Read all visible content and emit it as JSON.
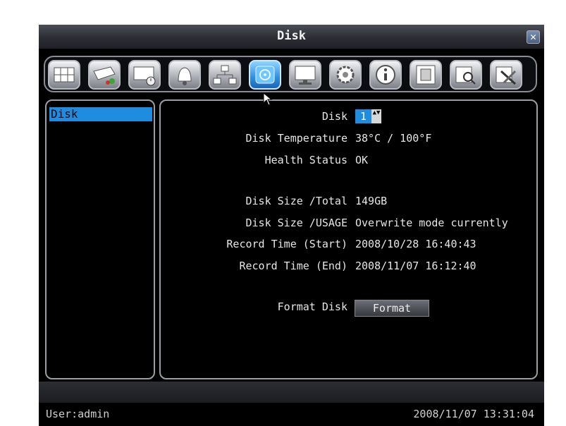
{
  "window": {
    "title": "Disk",
    "close_label": "✕"
  },
  "toolbar": {
    "icons": [
      "camera-grid-icon",
      "paint-icon",
      "record-schedule-icon",
      "alarm-bell-icon",
      "network-icon",
      "disk-icon",
      "monitor-icon",
      "settings-gear-icon",
      "info-icon",
      "film-icon",
      "search-icon",
      "tools-icon"
    ],
    "active": "disk-icon"
  },
  "sidebar": {
    "items": [
      {
        "label": "Disk",
        "selected": true
      }
    ]
  },
  "main": {
    "disk_label": "Disk",
    "disk_value": "1",
    "disk_stepper": "▲▼",
    "temperature_label": "Disk Temperature",
    "temperature_value": "38°C / 100°F",
    "health_label": "Health Status",
    "health_value": "OK",
    "size_total_label": "Disk Size /Total",
    "size_total_value": "149GB",
    "size_usage_label": "Disk Size /USAGE",
    "size_usage_value": "Overwrite mode currently",
    "record_start_label": "Record Time (Start)",
    "record_start_value": "2008/10/28  16:40:43",
    "record_end_label": "Record Time (End)",
    "record_end_value": "2008/11/07  16:12:40",
    "format_label": "Format Disk",
    "format_button": "Format"
  },
  "status": {
    "user": "User:admin",
    "datetime": "2008/11/07  13:31:04"
  },
  "colors": {
    "accent": "#1e8de0",
    "background": "#000000",
    "text": "#e6e6e6"
  }
}
